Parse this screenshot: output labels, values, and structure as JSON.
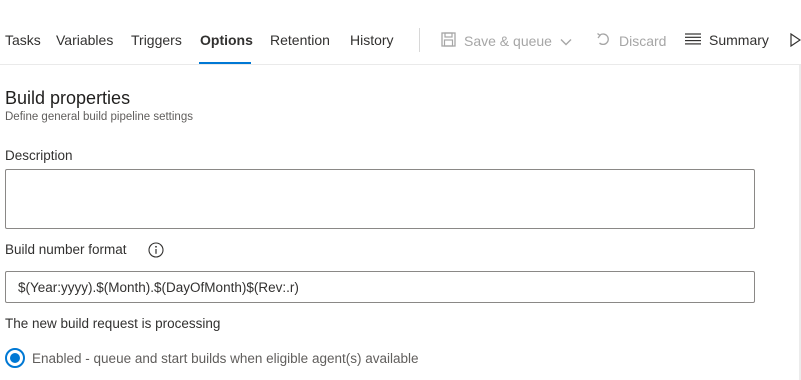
{
  "tabs": [
    {
      "label": "Tasks",
      "active": false
    },
    {
      "label": "Variables",
      "active": false
    },
    {
      "label": "Triggers",
      "active": false
    },
    {
      "label": "Options",
      "active": true
    },
    {
      "label": "Retention",
      "active": false
    },
    {
      "label": "History",
      "active": false
    }
  ],
  "toolbar": {
    "save_queue_label": "Save & queue",
    "discard_label": "Discard",
    "summary_label": "Summary"
  },
  "build_properties": {
    "title": "Build properties",
    "subtitle": "Define general build pipeline settings",
    "description_label": "Description",
    "description_value": "",
    "build_number_label": "Build number format",
    "build_number_value": "$(Year:yyyy).$(Month).$(DayOfMonth)$(Rev:.r)",
    "processing_label": "The new build request is processing",
    "enabled_option": "Enabled - queue and start builds when eligible agent(s) available"
  },
  "colors": {
    "accent": "#0078d4",
    "disabled_text": "#a6a6a6"
  },
  "icons": {
    "save": "save-icon",
    "chevron": "chevron-down-icon",
    "discard": "undo-icon",
    "summary": "list-icon",
    "run": "play-icon",
    "info": "info-icon"
  }
}
